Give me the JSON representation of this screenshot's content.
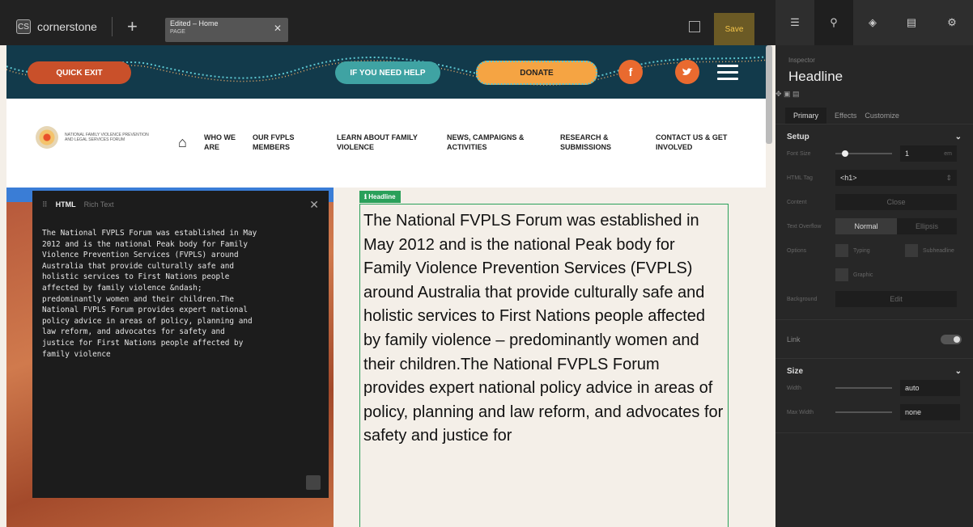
{
  "app": {
    "name": "cornerstone",
    "logo": "CS"
  },
  "tab": {
    "title": "Edited – Home",
    "subtitle": "PAGE"
  },
  "toolbar": {
    "save_label": "Save"
  },
  "banner": {
    "quick_exit": "QUICK EXIT",
    "help": "IF YOU NEED HELP",
    "donate": "DONATE",
    "facebook": "f"
  },
  "nav": {
    "logo_text": "NATIONAL FAMILY VIOLENCE PREVENTION AND LEGAL SERVICES FORUM",
    "links": [
      "WHO WE ARE",
      "OUR FVPLS MEMBERS",
      "LEARN ABOUT FAMILY VIOLENCE",
      "NEWS, CAMPAIGNS & ACTIVITIES",
      "RESEARCH & SUBMISSIONS",
      "CONTACT US & GET INVOLVED"
    ]
  },
  "html_editor": {
    "tab_html": "HTML",
    "tab_rich": "Rich Text",
    "content": "The National FVPLS Forum was established in May\n2012 and is the national Peak body for Family\nViolence Prevention Services (FVPLS) around\nAustralia that provide culturally safe and\nholistic services to First Nations people\naffected by family violence &ndash;\npredominantly women and their children.The\nNational FVPLS Forum provides expert national\npolicy advice in areas of policy, planning and\nlaw reform, and advocates for safety and\njustice for First Nations people affected by\nfamily violence"
  },
  "headline_tag": "Headline",
  "headline_text": "The National FVPLS Forum was established in May 2012 and is the national Peak body for Family Violence Prevention Services (FVPLS) around Australia that provide culturally safe and holistic services to First Nations people affected by family violence – predominantly women and their children.The National FVPLS Forum provides expert national policy advice in areas of policy, planning and law reform, and advocates for safety and justice for",
  "inspector": {
    "label": "Inspector",
    "title": "Headline",
    "subtabs": [
      "Primary",
      "Effects",
      "Customize"
    ],
    "setup": {
      "heading": "Setup",
      "font_size_label": "Font Size",
      "font_size_value": "1",
      "font_size_unit": "em",
      "html_tag_label": "HTML Tag",
      "html_tag_value": "<h1>",
      "content_label": "Content",
      "content_button": "Close",
      "overflow_label": "Text Overflow",
      "overflow_normal": "Normal",
      "overflow_ellipsis": "Ellipsis",
      "options_label": "Options",
      "opt_typing": "Typing",
      "opt_subheadline": "Subheadline",
      "opt_graphic": "Graphic",
      "background_label": "Background",
      "background_button": "Edit"
    },
    "link_label": "Link",
    "size": {
      "heading": "Size",
      "width_label": "Width",
      "width_value": "auto",
      "max_width_label": "Max Width",
      "max_width_value": "none"
    }
  }
}
